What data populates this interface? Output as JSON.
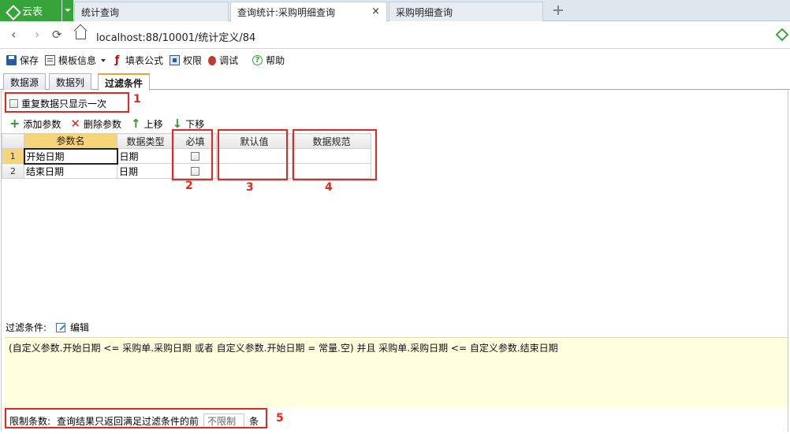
{
  "browser": {
    "app_name": "云表",
    "tabs": [
      {
        "label": "统计查询"
      },
      {
        "label": "查询统计:采购明细查询"
      },
      {
        "label": "采购明细查询"
      }
    ],
    "close_glyph": "×",
    "url": "localhost:88/10001/统计定义/84"
  },
  "toolbar": {
    "save": "保存",
    "template_info": "模板信息",
    "fill_formula": "填表公式",
    "permission": "权限",
    "debug": "调试",
    "help": "帮助"
  },
  "page_tabs": [
    "数据源",
    "数据列",
    "过滤条件"
  ],
  "options": {
    "show_duplicate_once": "重复数据只显示一次"
  },
  "param_toolbar": {
    "add": "添加参数",
    "delete": "删除参数",
    "move_up": "上移",
    "move_down": "下移"
  },
  "param_grid": {
    "columns": [
      "参数名",
      "数据类型",
      "必填",
      "默认值",
      "数据规范"
    ],
    "rows": [
      {
        "index": "1",
        "name": "开始日期",
        "type": "日期",
        "required": false,
        "default": "",
        "rule": ""
      },
      {
        "index": "2",
        "name": "结束日期",
        "type": "日期",
        "required": false,
        "default": "",
        "rule": ""
      }
    ]
  },
  "annotations": [
    "1",
    "2",
    "3",
    "4",
    "5"
  ],
  "filter": {
    "label": "过滤条件:",
    "edit": "编辑",
    "expression": "(自定义参数.开始日期 <= 采购单.采购日期  或者  自定义参数.开始日期 = 常量.空) 并且  采购单.采购日期 <= 自定义参数.结束日期"
  },
  "limit": {
    "label": "限制条数:",
    "text": "查询结果只返回满足过滤条件的前",
    "value": "不限制",
    "unit": "条"
  },
  "colors": {
    "brand_green": "#37a43a",
    "annotation_red": "#e8261b",
    "selected_header": "#f6d47a",
    "filter_bg": "#ffffe0"
  }
}
